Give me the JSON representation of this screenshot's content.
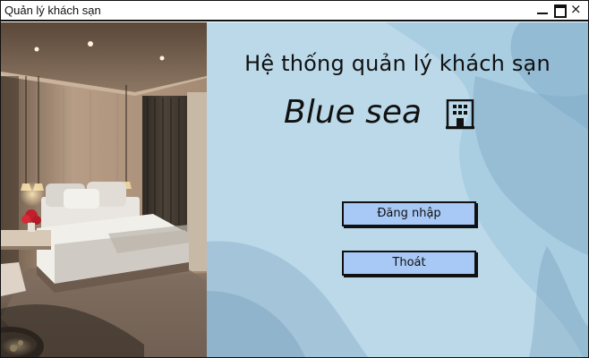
{
  "window": {
    "title": "Quản lý khách sạn",
    "controls": [
      "minimize-icon",
      "maximize-icon",
      "close-icon"
    ],
    "close_glyph": "×"
  },
  "main": {
    "heading": "Hệ thống quản lý khách sạn",
    "brand": "Blue sea",
    "brand_icon": "hotel-building-icon",
    "login_label": "Đăng nhập",
    "exit_label": "Thoát"
  },
  "colors": {
    "panel_bg": "#bcd9e9",
    "button_bg": "#a8c8f5",
    "border": "#111111"
  }
}
